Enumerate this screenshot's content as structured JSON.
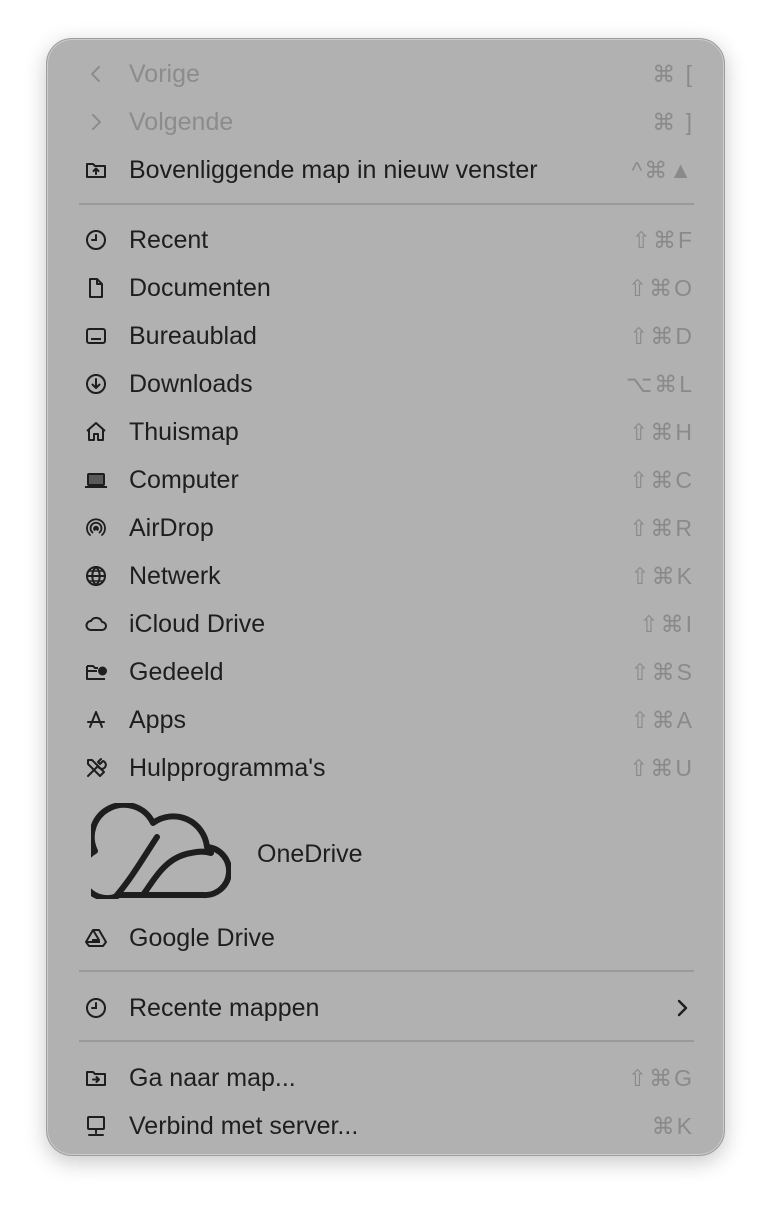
{
  "menu": {
    "nav_items": [
      {
        "label": "Vorige",
        "shortcut": "⌘ [",
        "icon": "chevron-left-icon",
        "disabled": true
      },
      {
        "label": "Volgende",
        "shortcut": "⌘ ]",
        "icon": "chevron-right-icon",
        "disabled": true
      },
      {
        "label": "Bovenliggende map in nieuw venster",
        "shortcut": "^⌘▲",
        "icon": "folder-up-icon",
        "disabled": false
      }
    ],
    "places": [
      {
        "label": "Recent",
        "shortcut": "⇧⌘F",
        "icon": "clock-icon"
      },
      {
        "label": "Documenten",
        "shortcut": "⇧⌘O",
        "icon": "document-icon"
      },
      {
        "label": "Bureaublad",
        "shortcut": "⇧⌘D",
        "icon": "desktop-icon"
      },
      {
        "label": "Downloads",
        "shortcut": "⌥⌘L",
        "icon": "download-icon"
      },
      {
        "label": "Thuismap",
        "shortcut": "⇧⌘H",
        "icon": "house-icon"
      },
      {
        "label": "Computer",
        "shortcut": "⇧⌘C",
        "icon": "laptop-icon"
      },
      {
        "label": "AirDrop",
        "shortcut": "⇧⌘R",
        "icon": "airdrop-icon"
      },
      {
        "label": "Netwerk",
        "shortcut": "⇧⌘K",
        "icon": "globe-icon"
      },
      {
        "label": "iCloud Drive",
        "shortcut": "⇧⌘I",
        "icon": "cloud-icon"
      },
      {
        "label": "Gedeeld",
        "shortcut": "⇧⌘S",
        "icon": "shared-folder-icon"
      },
      {
        "label": "Apps",
        "shortcut": "⇧⌘A",
        "icon": "apps-icon"
      },
      {
        "label": "Hulpprogramma's",
        "shortcut": "⇧⌘U",
        "icon": "tools-icon"
      }
    ],
    "onedrive_label": "OneDrive",
    "google_drive_label": "Google Drive",
    "recent_folders_label": "Recente mappen",
    "goto_label": "Ga naar map...",
    "goto_shortcut": "⇧⌘G",
    "connect_label": "Verbind met server...",
    "connect_shortcut": "⌘K"
  }
}
